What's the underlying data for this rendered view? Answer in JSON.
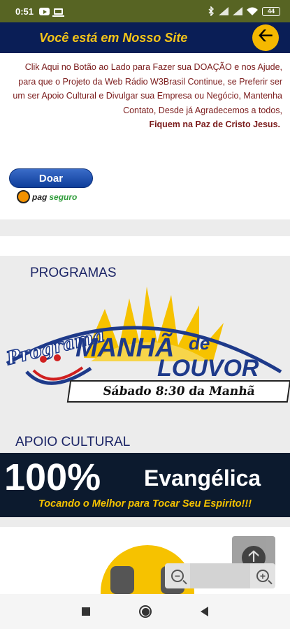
{
  "status_bar": {
    "time": "0:51",
    "battery": "44",
    "icons": [
      "youtube-icon",
      "monitor-icon",
      "bluetooth-icon",
      "signal-icon",
      "signal-icon",
      "wifi-icon",
      "battery-icon"
    ]
  },
  "header": {
    "title": "Você está em Nosso Site",
    "back_icon": "arrow-left-icon",
    "colors": {
      "background": "#0a1e56",
      "title": "#f5c518",
      "button": "#f5b800"
    }
  },
  "donation": {
    "text": "Clik Aqui no Botão ao Lado para Fazer sua DOAÇÃO e nos Ajude, para que o Projeto da Web Rádio W3Brasil Continue, se Preferir ser um ser Apoio Cultural e Divulgar sua Empresa ou Negócio, Mantenha Contato, Desde já Agradecemos a todos,",
    "closing": "Fiquem na Paz de Cristo Jesus.",
    "button_label": "Doar",
    "payment_brand_pag": "pag",
    "payment_brand_seguro": "seguro"
  },
  "programas": {
    "heading": "PROGRAMAS",
    "banner": {
      "word_programa": "Programa",
      "word_manha": "MANHÃ",
      "word_de": "de",
      "word_louvor": "LOUVOR",
      "schedule": "Sábado 8:30 da Manhã"
    }
  },
  "apoio": {
    "heading": "APOIO CULTURAL",
    "banner": {
      "percent": "100%",
      "name": "Evangélica",
      "slogan": "Tocando o Melhor para Tocar Seu Espirito!!!"
    }
  },
  "controls": {
    "scroll_top_icon": "arrow-up-icon",
    "zoom_out": "−",
    "zoom_in": "+"
  },
  "nav_bar": {
    "icons": [
      "recents-square-icon",
      "home-circle-icon",
      "back-triangle-icon"
    ]
  }
}
